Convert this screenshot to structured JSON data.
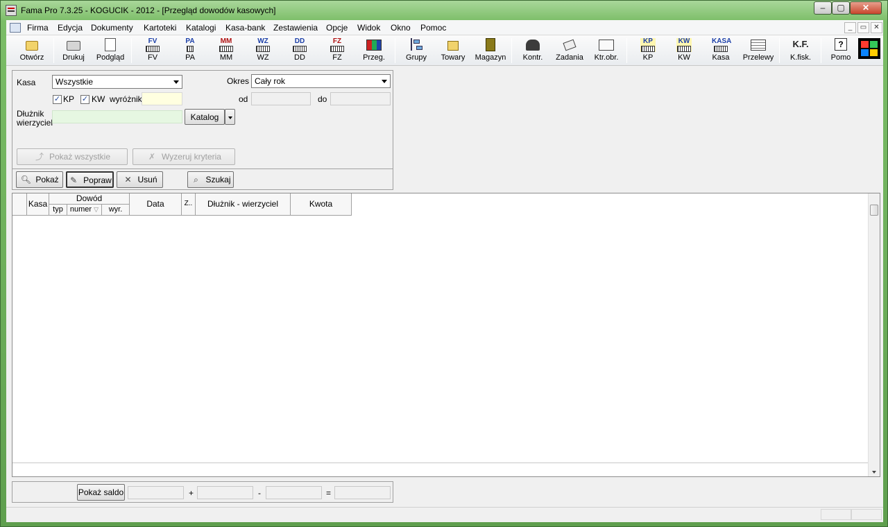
{
  "window": {
    "title": "Fama Pro 7.3.25 - KOGUCIK - 2012 - [Przegląd dowodów kasowych]",
    "caption_min": "–",
    "caption_max": "▢",
    "caption_close": "✕"
  },
  "menu": {
    "items": [
      "Firma",
      "Edycja",
      "Dokumenty",
      "Kartoteki",
      "Katalogi",
      "Kasa-bank",
      "Zestawienia",
      "Opcje",
      "Widok",
      "Okno",
      "Pomoc"
    ],
    "mdi_min": "_",
    "mdi_restore": "▭",
    "mdi_close": "✕"
  },
  "toolbar": {
    "buttons": [
      {
        "label": "Otwórz",
        "icon": "folder-icon"
      },
      {
        "label": "Drukuj",
        "icon": "printer-icon"
      },
      {
        "label": "Podgląd",
        "icon": "preview-icon"
      },
      {
        "label": "FV",
        "icon": "invoice-fv-icon",
        "code": "FV",
        "color": "#1c3fa8"
      },
      {
        "label": "PA",
        "icon": "receipt-pa-icon",
        "code": "PA",
        "color": "#1c3fa8"
      },
      {
        "label": "MM",
        "icon": "transfer-mm-icon",
        "code": "MM",
        "color": "#b01212"
      },
      {
        "label": "WZ",
        "icon": "release-wz-icon",
        "code": "WZ",
        "color": "#1c3fa8"
      },
      {
        "label": "DD",
        "icon": "delivery-dd-icon",
        "code": "DD",
        "color": "#1c3fa8"
      },
      {
        "label": "FZ",
        "icon": "purchase-fz-icon",
        "code": "FZ",
        "color": "#b01212"
      },
      {
        "label": "Przeg.",
        "icon": "binders-icon"
      },
      {
        "label": "Grupy",
        "icon": "groups-tree-icon"
      },
      {
        "label": "Towary",
        "icon": "goods-icon"
      },
      {
        "label": "Magazyn",
        "icon": "warehouse-door-icon"
      },
      {
        "label": "Kontr.",
        "icon": "contractors-icon"
      },
      {
        "label": "Zadania",
        "icon": "tasks-icon"
      },
      {
        "label": "Ktr.obr.",
        "icon": "turnover-icon"
      },
      {
        "label": "KP",
        "icon": "cash-in-kp-icon",
        "code": "KP",
        "color": "#1c3fa8"
      },
      {
        "label": "KW",
        "icon": "cash-out-kw-icon",
        "code": "KW",
        "color": "#1c3fa8"
      },
      {
        "label": "Kasa",
        "icon": "cash-register-icon",
        "code": "KASA",
        "color": "#1c3fa8"
      },
      {
        "label": "Przelewy",
        "icon": "transfers-icon"
      },
      {
        "label": "K.fisk.",
        "icon": "fiscal-icon",
        "code": "K.F.",
        "color": "#222222"
      },
      {
        "label": "Pomo",
        "icon": "help-icon"
      }
    ]
  },
  "filters": {
    "kasa_label": "Kasa",
    "kasa_value": "Wszystkie",
    "okres_label": "Okres",
    "okres_value": "Cały rok",
    "kp_label": "KP",
    "kw_label": "KW",
    "kp_checked": "✓",
    "kw_checked": "✓",
    "wyroznik_label": "wyróżnik",
    "od_label": "od",
    "do_label": "do",
    "dluznik_label_1": "Dłużnik",
    "dluznik_label_2": "wierzyciel",
    "katalog_label": "Katalog",
    "pokaz_wszystkie": "Pokaż wszystkie",
    "wyzeruj": "Wyzeruj kryteria"
  },
  "actions": {
    "pokaz": "Pokaż",
    "popraw": "Popraw",
    "usun": "Usuń",
    "szukaj": "Szukaj"
  },
  "grid": {
    "col_kasa": "Kasa",
    "col_dowod": "Dowód",
    "col_typ": "typ",
    "col_numer": "numer",
    "col_wyr": "wyr.",
    "col_data": "Data",
    "col_z": "Z..",
    "col_dluznik": "Dłużnik - wierzyciel",
    "col_kwota": "Kwota",
    "sort_indicator": "▽",
    "rows": []
  },
  "saldo": {
    "button": "Pokaż saldo",
    "plus": "+",
    "minus": "-",
    "equals": "="
  }
}
